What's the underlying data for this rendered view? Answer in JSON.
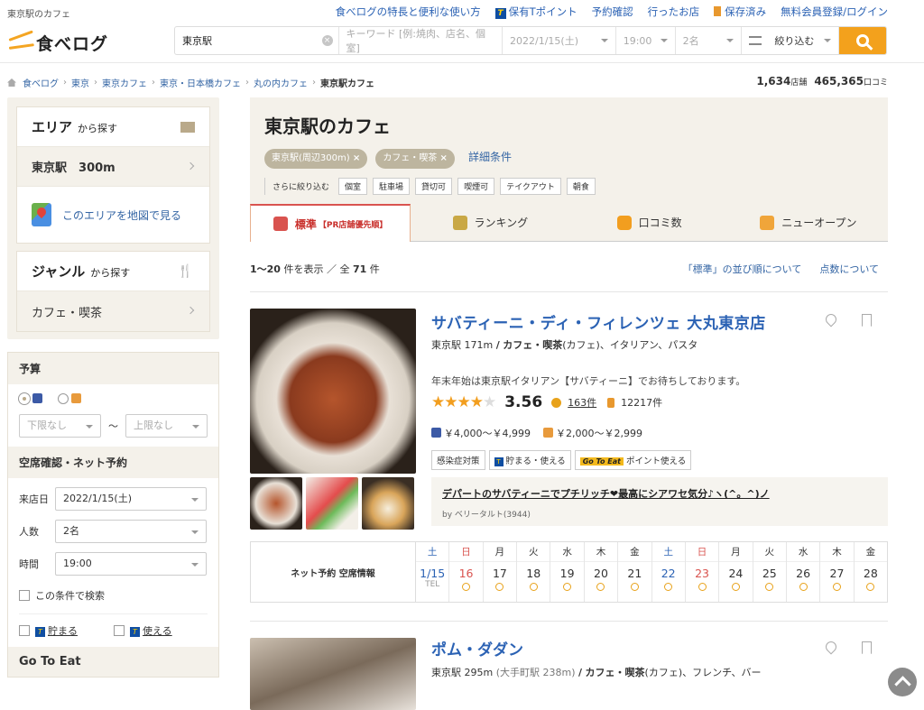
{
  "site_label": "東京駅のカフェ",
  "topnav": [
    "食べログの特長と便利な使い方",
    "保有Tポイント",
    "予約確認",
    "行ったお店",
    "保存済み",
    "無料会員登録/ログイン"
  ],
  "logo": "食べログ",
  "search": {
    "area": "東京駅",
    "keyword_placeholder": "キーワード [例:焼肉、店名、個室]",
    "date": "2022/1/15(土)",
    "time": "19:00",
    "people": "2名",
    "refine": "絞り込む"
  },
  "breadcrumb": [
    "食べログ",
    "東京",
    "東京カフェ",
    "東京・日本橋カフェ",
    "丸の内カフェ",
    "東京駅カフェ"
  ],
  "counts": {
    "shops": "1,634",
    "shops_unit": "店舗",
    "reviews": "465,365",
    "reviews_unit": "口コミ"
  },
  "sidebar": {
    "area_title": "エリア",
    "area_sub": "から探す",
    "area_value": "東京駅",
    "area_dist": "300m",
    "map_link": "このエリアを地図で見る",
    "genre_title": "ジャンル",
    "genre_sub": "から探す",
    "genre_value": "カフェ・喫茶",
    "budget_title": "予算",
    "budget_min": "下限なし",
    "budget_max": "上限なし",
    "tilde": "〜",
    "reserve_title": "空席確認・ネット予約",
    "date_label": "来店日",
    "date_value": "2022/1/15(土)",
    "people_label": "人数",
    "people_value": "2名",
    "time_label": "時間",
    "time_value": "19:00",
    "cond_label": "この条件で検索",
    "tpoint_save": "貯まる",
    "tpoint_use": "使える",
    "goto_title": "Go To Eat"
  },
  "main": {
    "title": "東京駅のカフェ",
    "chips": [
      "東京駅(周辺300m)",
      "カフェ・喫茶"
    ],
    "chip_close": "×",
    "detail": "詳細条件",
    "refine_label": "さらに絞り込む",
    "refine_tags": [
      "個室",
      "駐車場",
      "貸切可",
      "喫煙可",
      "テイクアウト",
      "朝食"
    ],
    "tabs": [
      "標準",
      "【PR店舗優先順】",
      "ランキング",
      "口コミ数",
      "ニューオープン"
    ],
    "result_range": "1〜20",
    "result_mid": "件を表示 ／ 全",
    "result_total": "71",
    "result_unit": "件",
    "link_order": "「標準」の並び順について",
    "link_score": "点数について"
  },
  "restaurants": [
    {
      "name": "サバティーニ・ディ・フィレンツェ 大丸東京店",
      "station": "東京駅 171m",
      "slash": "/",
      "genre_bold": "カフェ・喫茶",
      "genre_rest": "(カフェ)、イタリアン、パスタ",
      "pr": "年末年始は東京駅イタリアン【サバティーニ】でお待ちしております。",
      "rating": 3.56,
      "rating_text": "3.56",
      "reviews": "163件",
      "saves": "12217件",
      "dinner": "￥4,000〜￥4,999",
      "lunch": "￥2,000〜￥2,999",
      "features": [
        "感染症対策",
        "貯まる・使える",
        "Go To Eat",
        "ポイント使える"
      ],
      "review_quote": "デパートのサバティーニでプチリッチ❤最高にシアワセ気分♪ヽ(^。^)ノ",
      "review_by": "by ベリータルト(3944)"
    },
    {
      "name": "ポム・ダダン",
      "station": "東京駅 295m",
      "station_sub": "(大手町駅 238m)",
      "slash": "/",
      "genre_bold": "カフェ・喫茶",
      "genre_rest": "(カフェ)、フレンチ、バー"
    }
  ],
  "calendar": {
    "label": "ネット予約 空席情報",
    "days": [
      {
        "w": "土",
        "n": "1/15",
        "t": "sat",
        "tel": "TEL"
      },
      {
        "w": "日",
        "n": "16",
        "t": "sun"
      },
      {
        "w": "月",
        "n": "17"
      },
      {
        "w": "火",
        "n": "18"
      },
      {
        "w": "水",
        "n": "19"
      },
      {
        "w": "木",
        "n": "20"
      },
      {
        "w": "金",
        "n": "21"
      },
      {
        "w": "土",
        "n": "22",
        "t": "sat"
      },
      {
        "w": "日",
        "n": "23",
        "t": "sun"
      },
      {
        "w": "月",
        "n": "24"
      },
      {
        "w": "火",
        "n": "25"
      },
      {
        "w": "水",
        "n": "26"
      },
      {
        "w": "木",
        "n": "27"
      },
      {
        "w": "金",
        "n": "28"
      }
    ]
  },
  "colors": {
    "accent": "#f3a11c",
    "link": "#2b62b4",
    "panel": "#f4f1ea",
    "red": "#d9534f"
  }
}
